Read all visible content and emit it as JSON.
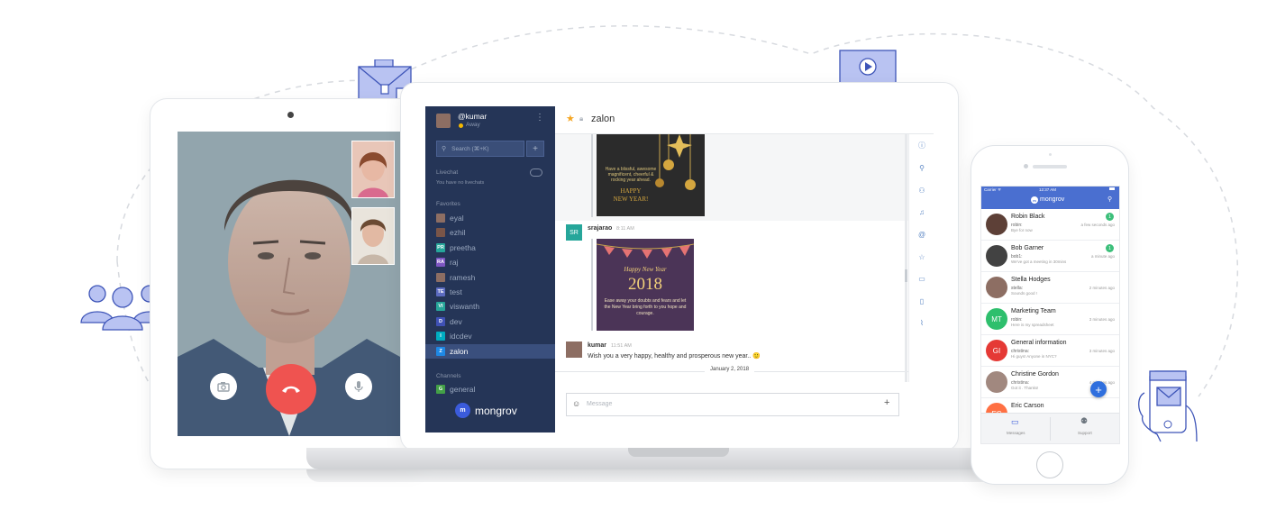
{
  "colors": {
    "sidebar_bg": "#253557",
    "accent_blue": "#3b5bdb",
    "phone_header": "#4a6fd0",
    "hangup_red": "#ef5350",
    "badge_green": "#3cbf7a"
  },
  "tablet": {
    "call_controls": [
      "camera-icon",
      "hangup-icon",
      "mic-icon"
    ]
  },
  "laptop": {
    "sidebar": {
      "user": "@kumar",
      "status": "Away",
      "search_placeholder": "Search (⌘+K)",
      "livechat_label": "Livechat",
      "livechat_empty": "You have no livechats",
      "favorites_label": "Favorites",
      "favorites": [
        {
          "initials": "",
          "name": "eyal",
          "color": "#8d6e63"
        },
        {
          "initials": "",
          "name": "ezhil",
          "color": "#795548"
        },
        {
          "initials": "PR",
          "name": "preetha",
          "color": "#26a69a"
        },
        {
          "initials": "RA",
          "name": "raj",
          "color": "#7e57c2"
        },
        {
          "initials": "",
          "name": "ramesh",
          "color": "#8d6e63"
        },
        {
          "initials": "TE",
          "name": "test",
          "color": "#5c6bc0"
        },
        {
          "initials": "VI",
          "name": "viswanth",
          "color": "#26a69a"
        },
        {
          "initials": "D",
          "name": "dev",
          "color": "#3f51b5"
        },
        {
          "initials": "I",
          "name": "idcdev",
          "color": "#00acc1"
        },
        {
          "initials": "Z",
          "name": "zalon",
          "color": "#1e88e5"
        }
      ],
      "channels_label": "Channels",
      "channels": [
        {
          "initials": "G",
          "name": "general",
          "color": "#43a047"
        }
      ],
      "brand": "mongrov"
    },
    "chat": {
      "room": "zalon",
      "card1_text": "Have a blissful, awesome magnificent, cheerful & rocking year ahead.",
      "card1_happy": "HAPPY",
      "card1_newyear": "NEW YEAR!",
      "msg1_avatar": "SR",
      "msg1_user": "srajarao",
      "msg1_time": "8:11 AM",
      "card2_title": "Happy New Year",
      "card2_year": "2018",
      "card2_text": "Ease away your doubts and fears and let the New Year bring forth to you hope and courage.",
      "msg2_user": "kumar",
      "msg2_time": "11:51 AM",
      "msg2_text": "Wish you a very happy, healthy and prosperous new year.. 🙂",
      "date_divider": "January 2, 2018",
      "composer_placeholder": "Message"
    }
  },
  "phone": {
    "status_carrier": "Carrier ᯤ",
    "status_time": "12:37 AM",
    "brand": "mongrov",
    "conversations": [
      {
        "name": "Robin Black",
        "sub1": "robin:",
        "sub2": "Bye for now",
        "time": "a few seconds ago",
        "badge": "1",
        "avatar_color": "#5d4037",
        "initials": ""
      },
      {
        "name": "Bob Garner",
        "sub1": "bob1:",
        "sub2": "We've got a meeting in 30mins",
        "time": "a minute ago",
        "badge": "1",
        "avatar_color": "#424242",
        "initials": ""
      },
      {
        "name": "Stella Hodges",
        "sub1": "stella:",
        "sub2": "Sounds good !",
        "time": "2 minutes ago",
        "badge": "",
        "avatar_color": "#8d6e63",
        "initials": ""
      },
      {
        "name": "Marketing Team",
        "sub1": "robin:",
        "sub2": "Here is my spreadsheet",
        "time": "3 minutes ago",
        "badge": "",
        "avatar_color": "#2ebf6d",
        "initials": "MT"
      },
      {
        "name": "General information",
        "sub1": "christina:",
        "sub2": "Hi guys! Anyone in NYC?",
        "time": "3 minutes ago",
        "badge": "",
        "avatar_color": "#e53935",
        "initials": "GI"
      },
      {
        "name": "Christine Gordon",
        "sub1": "christina:",
        "sub2": "Got it . Thanks!",
        "time": "4 minutes ago",
        "badge": "",
        "avatar_color": "#a1887f",
        "initials": ""
      },
      {
        "name": "Eric Carson",
        "sub1": "",
        "sub2": "",
        "time": "",
        "badge": "",
        "avatar_color": "#ff7043",
        "initials": "EC"
      }
    ],
    "tabs": [
      "Messages",
      "Support"
    ]
  }
}
